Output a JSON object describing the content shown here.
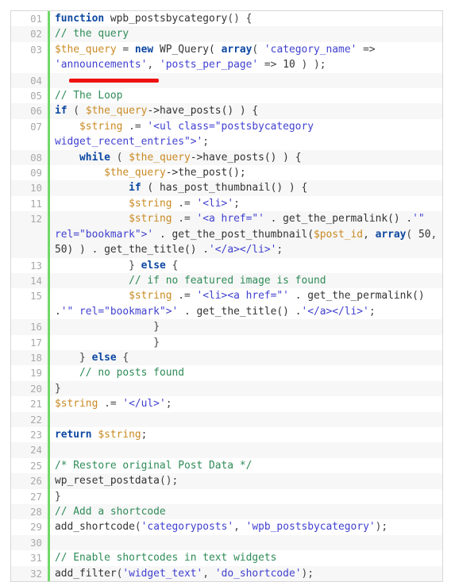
{
  "editor": {
    "language": "php",
    "gutter_bar_color": "#70d96a",
    "stripe_color": "#f7f7f7",
    "border_color": "#d8d8d8",
    "annotation": {
      "type": "underline",
      "color": "#ee1111",
      "target_text": "'announcements'"
    }
  },
  "lines": [
    {
      "num": "01",
      "text": "function wpb_postsbycategory() {"
    },
    {
      "num": "02",
      "text": "// the query"
    },
    {
      "num": "03",
      "text": "$the_query = new WP_Query( array( 'category_name' => 'announcements', 'posts_per_page' => 10 ) );"
    },
    {
      "num": "04",
      "text": ""
    },
    {
      "num": "05",
      "text": "// The Loop"
    },
    {
      "num": "06",
      "text": "if ( $the_query->have_posts() ) {"
    },
    {
      "num": "07",
      "text": "    $string .= '<ul class=\"postsbycategory widget_recent_entries\">';"
    },
    {
      "num": "08",
      "text": "    while ( $the_query->have_posts() ) {"
    },
    {
      "num": "09",
      "text": "        $the_query->the_post();"
    },
    {
      "num": "10",
      "text": "            if ( has_post_thumbnail() ) {"
    },
    {
      "num": "11",
      "text": "            $string .= '<li>';"
    },
    {
      "num": "12",
      "text": "            $string .= '<a href=\"' . get_the_permalink() .'\" rel=\"bookmark\">' . get_the_post_thumbnail($post_id, array( 50, 50) ) . get_the_title() .'</a></li>';"
    },
    {
      "num": "13",
      "text": "            } else {"
    },
    {
      "num": "14",
      "text": "            // if no featured image is found"
    },
    {
      "num": "15",
      "text": "            $string .= '<li><a href=\"' . get_the_permalink() .'\" rel=\"bookmark\">' . get_the_title() .'</a></li>';"
    },
    {
      "num": "16",
      "text": "                }"
    },
    {
      "num": "17",
      "text": "                }"
    },
    {
      "num": "18",
      "text": "    } else {"
    },
    {
      "num": "19",
      "text": "    // no posts found"
    },
    {
      "num": "20",
      "text": "}"
    },
    {
      "num": "21",
      "text": "$string .= '</ul>';"
    },
    {
      "num": "22",
      "text": ""
    },
    {
      "num": "23",
      "text": "return $string;"
    },
    {
      "num": "24",
      "text": ""
    },
    {
      "num": "25",
      "text": "/* Restore original Post Data */"
    },
    {
      "num": "26",
      "text": "wp_reset_postdata();"
    },
    {
      "num": "27",
      "text": "}"
    },
    {
      "num": "28",
      "text": "// Add a shortcode"
    },
    {
      "num": "29",
      "text": "add_shortcode('categoryposts', 'wpb_postsbycategory');"
    },
    {
      "num": "30",
      "text": ""
    },
    {
      "num": "31",
      "text": "// Enable shortcodes in text widgets"
    },
    {
      "num": "32",
      "text": "add_filter('widget_text', 'do_shortcode');"
    }
  ],
  "tokens": [
    [
      {
        "t": "function ",
        "c": "kw"
      },
      {
        "t": "wpb_postsbycategory",
        "c": "def"
      },
      {
        "t": "() {",
        "c": "pun"
      }
    ],
    [
      {
        "t": "// the query",
        "c": "cmt"
      }
    ],
    [
      {
        "t": "$the_query",
        "c": "var"
      },
      {
        "t": " = ",
        "c": "pun"
      },
      {
        "t": "new",
        "c": "kw"
      },
      {
        "t": " WP_Query( ",
        "c": "def"
      },
      {
        "t": "array",
        "c": "kw"
      },
      {
        "t": "( ",
        "c": "pun"
      },
      {
        "t": "'category_name'",
        "c": "str"
      },
      {
        "t": " => ",
        "c": "pun"
      },
      {
        "t": "'announcements'",
        "c": "str"
      },
      {
        "t": ", ",
        "c": "pun"
      },
      {
        "t": "'posts_per_page'",
        "c": "str"
      },
      {
        "t": " => ",
        "c": "pun"
      },
      {
        "t": "10",
        "c": "num"
      },
      {
        "t": " ) );",
        "c": "pun"
      }
    ],
    [
      {
        "t": "",
        "c": "pun"
      }
    ],
    [
      {
        "t": "// The Loop",
        "c": "cmt"
      }
    ],
    [
      {
        "t": "if",
        "c": "kw"
      },
      {
        "t": " ( ",
        "c": "pun"
      },
      {
        "t": "$the_query",
        "c": "var"
      },
      {
        "t": "->have_posts() ) {",
        "c": "def"
      }
    ],
    [
      {
        "t": "    ",
        "c": "pun"
      },
      {
        "t": "$string",
        "c": "var"
      },
      {
        "t": " .= ",
        "c": "pun"
      },
      {
        "t": "'<ul class=\"postsbycategory widget_recent_entries\">'",
        "c": "str"
      },
      {
        "t": ";",
        "c": "pun"
      }
    ],
    [
      {
        "t": "    ",
        "c": "pun"
      },
      {
        "t": "while",
        "c": "kw"
      },
      {
        "t": " ( ",
        "c": "pun"
      },
      {
        "t": "$the_query",
        "c": "var"
      },
      {
        "t": "->have_posts() ) {",
        "c": "def"
      }
    ],
    [
      {
        "t": "        ",
        "c": "pun"
      },
      {
        "t": "$the_query",
        "c": "var"
      },
      {
        "t": "->the_post();",
        "c": "def"
      }
    ],
    [
      {
        "t": "            ",
        "c": "pun"
      },
      {
        "t": "if",
        "c": "kw"
      },
      {
        "t": " ( has_post_thumbnail() ) {",
        "c": "def"
      }
    ],
    [
      {
        "t": "            ",
        "c": "pun"
      },
      {
        "t": "$string",
        "c": "var"
      },
      {
        "t": " .= ",
        "c": "pun"
      },
      {
        "t": "'<li>'",
        "c": "str"
      },
      {
        "t": ";",
        "c": "pun"
      }
    ],
    [
      {
        "t": "            ",
        "c": "pun"
      },
      {
        "t": "$string",
        "c": "var"
      },
      {
        "t": " .= ",
        "c": "pun"
      },
      {
        "t": "'<a href=\"'",
        "c": "str"
      },
      {
        "t": " . get_the_permalink() .",
        "c": "def"
      },
      {
        "t": "'\" rel=\"bookmark\">'",
        "c": "str"
      },
      {
        "t": " . get_the_post_thumbnail(",
        "c": "def"
      },
      {
        "t": "$post_id",
        "c": "var"
      },
      {
        "t": ", ",
        "c": "pun"
      },
      {
        "t": "array",
        "c": "kw"
      },
      {
        "t": "( ",
        "c": "pun"
      },
      {
        "t": "50",
        "c": "num"
      },
      {
        "t": ", ",
        "c": "pun"
      },
      {
        "t": "50",
        "c": "num"
      },
      {
        "t": ") ) . get_the_title() .",
        "c": "def"
      },
      {
        "t": "'</a></li>'",
        "c": "str"
      },
      {
        "t": ";",
        "c": "pun"
      }
    ],
    [
      {
        "t": "            } ",
        "c": "pun"
      },
      {
        "t": "else",
        "c": "kw"
      },
      {
        "t": " {",
        "c": "pun"
      }
    ],
    [
      {
        "t": "            ",
        "c": "pun"
      },
      {
        "t": "// if no featured image is found",
        "c": "cmt"
      }
    ],
    [
      {
        "t": "            ",
        "c": "pun"
      },
      {
        "t": "$string",
        "c": "var"
      },
      {
        "t": " .= ",
        "c": "pun"
      },
      {
        "t": "'<li><a href=\"'",
        "c": "str"
      },
      {
        "t": " . get_the_permalink() .",
        "c": "def"
      },
      {
        "t": "'\" rel=\"bookmark\">'",
        "c": "str"
      },
      {
        "t": " . get_the_title() .",
        "c": "def"
      },
      {
        "t": "'</a></li>'",
        "c": "str"
      },
      {
        "t": ";",
        "c": "pun"
      }
    ],
    [
      {
        "t": "                }",
        "c": "pun"
      }
    ],
    [
      {
        "t": "                }",
        "c": "pun"
      }
    ],
    [
      {
        "t": "    } ",
        "c": "pun"
      },
      {
        "t": "else",
        "c": "kw"
      },
      {
        "t": " {",
        "c": "pun"
      }
    ],
    [
      {
        "t": "    ",
        "c": "pun"
      },
      {
        "t": "// no posts found",
        "c": "cmt"
      }
    ],
    [
      {
        "t": "}",
        "c": "pun"
      }
    ],
    [
      {
        "t": "$string",
        "c": "var"
      },
      {
        "t": " .= ",
        "c": "pun"
      },
      {
        "t": "'</ul>'",
        "c": "str"
      },
      {
        "t": ";",
        "c": "pun"
      }
    ],
    [
      {
        "t": "",
        "c": "pun"
      }
    ],
    [
      {
        "t": "return",
        "c": "kw"
      },
      {
        "t": " ",
        "c": "pun"
      },
      {
        "t": "$string",
        "c": "var"
      },
      {
        "t": ";",
        "c": "pun"
      }
    ],
    [
      {
        "t": "",
        "c": "pun"
      }
    ],
    [
      {
        "t": "/* Restore original Post Data */",
        "c": "cmt"
      }
    ],
    [
      {
        "t": "wp_reset_postdata",
        "c": "def"
      },
      {
        "t": "();",
        "c": "pun"
      }
    ],
    [
      {
        "t": "}",
        "c": "pun"
      }
    ],
    [
      {
        "t": "// Add a shortcode",
        "c": "cmt"
      }
    ],
    [
      {
        "t": "add_shortcode",
        "c": "def"
      },
      {
        "t": "(",
        "c": "pun"
      },
      {
        "t": "'categoryposts'",
        "c": "str"
      },
      {
        "t": ", ",
        "c": "pun"
      },
      {
        "t": "'wpb_postsbycategory'",
        "c": "str"
      },
      {
        "t": ");",
        "c": "pun"
      }
    ],
    [
      {
        "t": "",
        "c": "pun"
      }
    ],
    [
      {
        "t": "// Enable shortcodes in text widgets",
        "c": "cmt"
      }
    ],
    [
      {
        "t": "add_filter",
        "c": "def"
      },
      {
        "t": "(",
        "c": "pun"
      },
      {
        "t": "'widget_text'",
        "c": "str"
      },
      {
        "t": ", ",
        "c": "pun"
      },
      {
        "t": "'do_shortcode'",
        "c": "str"
      },
      {
        "t": ");",
        "c": "pun"
      }
    ]
  ]
}
